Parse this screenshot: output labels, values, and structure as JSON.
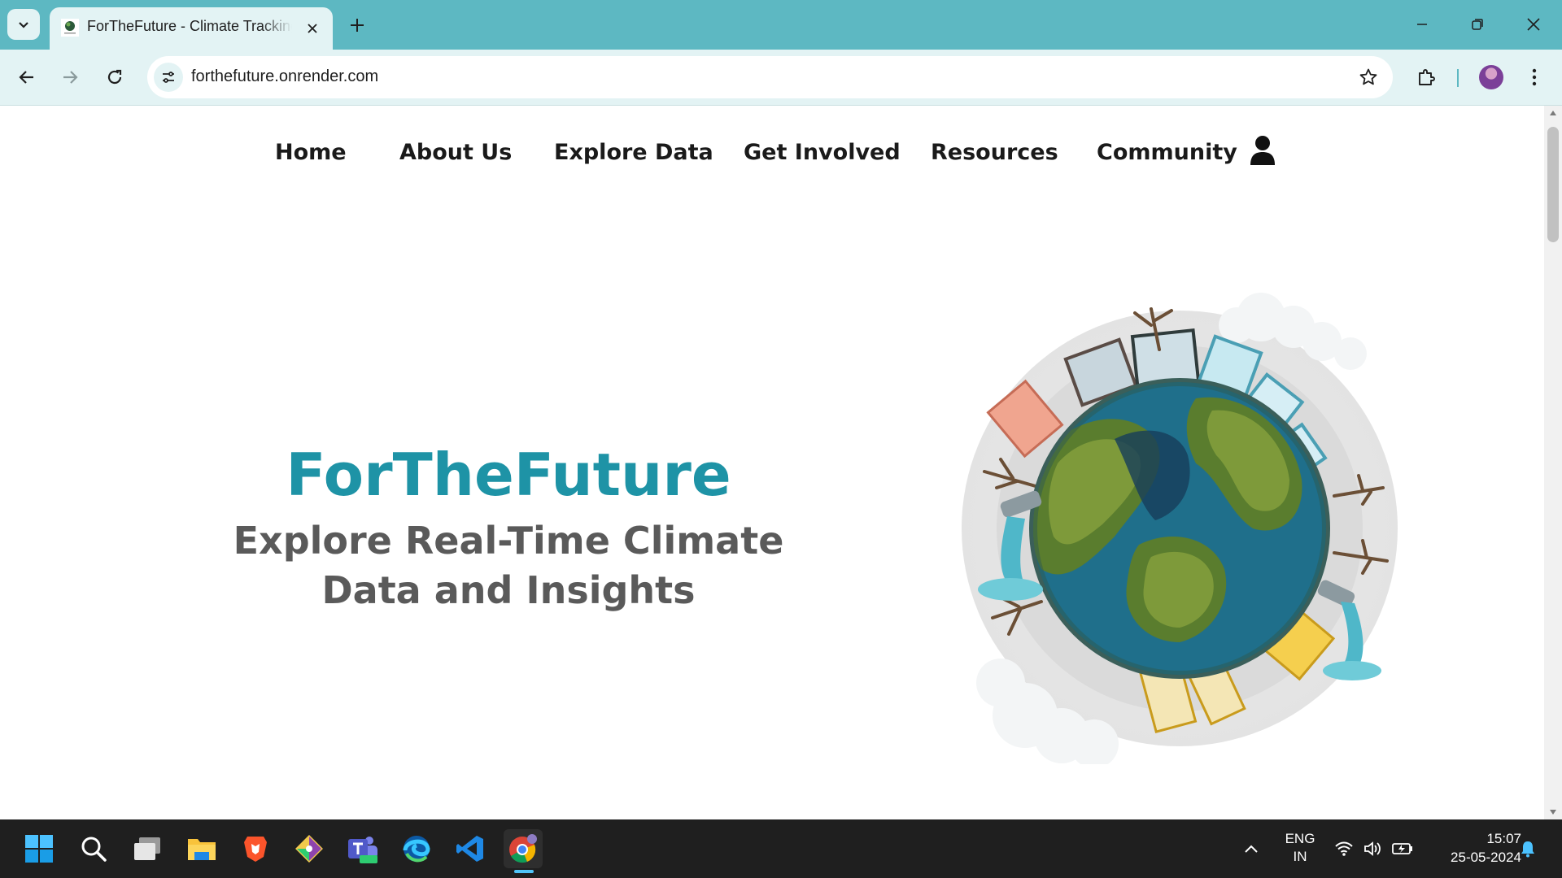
{
  "browser": {
    "tab": {
      "title": "ForTheFuture - Climate Tracking",
      "favicon": "globe-favicon-icon"
    },
    "address_bar": {
      "url": "forthefuture.onrender.com"
    },
    "colors": {
      "frame": "#5db8c2",
      "toolbar": "#e3f3f4"
    }
  },
  "site": {
    "nav": {
      "items": [
        "Home",
        "About Us",
        "Explore Data",
        "Get Involved",
        "Resources",
        "Community"
      ],
      "account_icon": "user-icon"
    },
    "hero": {
      "title": "ForTheFuture",
      "subtitle": "Explore Real-Time Climate Data and Insights",
      "image": "polluted-earth-globe-illustration"
    },
    "colors": {
      "title": "#1e93a6",
      "subtitle": "#5a5a5a"
    }
  },
  "taskbar": {
    "apps": [
      "windows-start-icon",
      "search-icon",
      "task-view-icon",
      "file-explorer-icon",
      "brave-browser-icon",
      "git-icon",
      "teams-icon",
      "edge-icon",
      "vscode-icon",
      "chrome-icon"
    ],
    "tray": {
      "language_line1": "ENG",
      "language_line2": "IN",
      "time": "15:07",
      "date": "25-05-2024"
    }
  }
}
